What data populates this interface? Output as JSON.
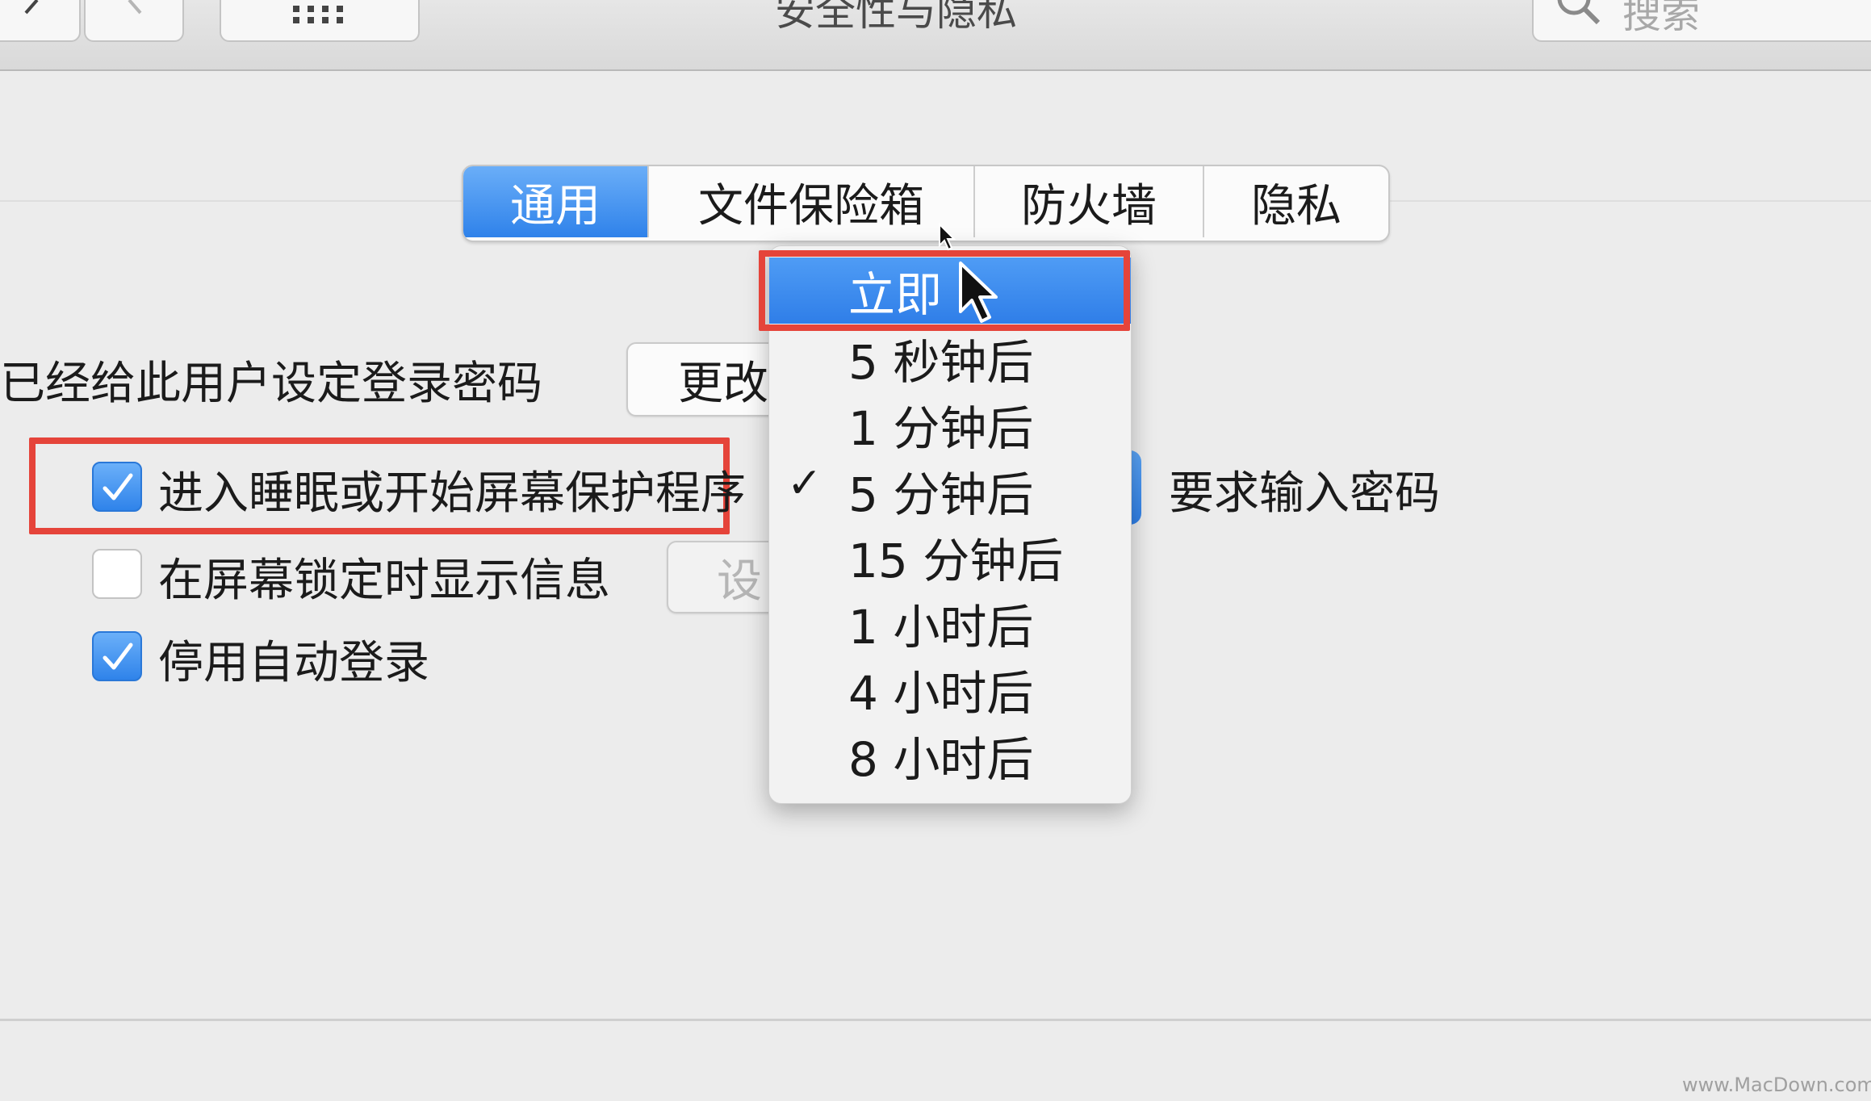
{
  "toolbar": {
    "window_title": "安全性与隐私",
    "search_placeholder": "搜索"
  },
  "tabs": [
    {
      "label": "通用",
      "active": true
    },
    {
      "label": "文件保险箱",
      "active": false
    },
    {
      "label": "防火墙",
      "active": false
    },
    {
      "label": "隐私",
      "active": false
    }
  ],
  "general": {
    "password_set_label": "已经给此用户设定登录密码",
    "change_password_button": "更改",
    "require_password_label": "进入睡眠或开始屏幕保护程序",
    "require_password_checked": true,
    "require_password_suffix": "要求输入密码",
    "show_message_label": "在屏幕锁定时显示信息",
    "show_message_checked": false,
    "set_message_button": "设",
    "disable_auto_login_label": "停用自动登录",
    "disable_auto_login_checked": true
  },
  "require_password_menu": {
    "options": [
      "立即",
      "5 秒钟后",
      "1 分钟后",
      "5 分钟后",
      "15 分钟后",
      "1 小时后",
      "4 小时后",
      "8 小时后"
    ],
    "highlighted": "立即",
    "checked": "5 分钟后"
  },
  "watermark": "www.MacDown.com",
  "colors": {
    "accent": "#3a8bf0",
    "annotation_red": "#e5443a"
  }
}
